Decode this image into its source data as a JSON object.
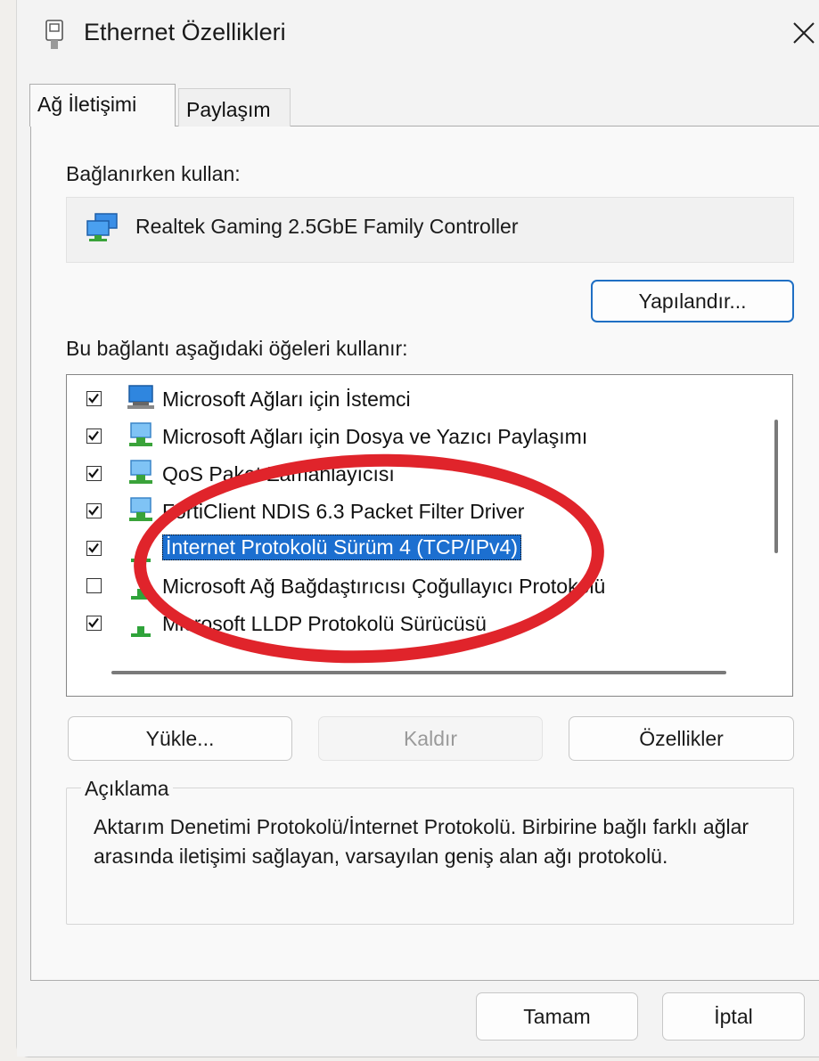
{
  "window": {
    "title": "Ethernet Özellikleri",
    "close_icon": "close-icon"
  },
  "tabs": [
    {
      "label": "Ağ İletişimi",
      "active": true
    },
    {
      "label": "Paylaşım",
      "active": false
    }
  ],
  "connect_using": {
    "label": "Bağlanırken kullan:",
    "adapter": "Realtek Gaming 2.5GbE Family Controller",
    "configure_button": "Yapılandır..."
  },
  "items_section": {
    "label": "Bu bağlantı aşağıdaki öğeleri kullanır:",
    "items": [
      {
        "label": "Microsoft Ağları için İstemci",
        "checked": true,
        "icon": "network-client-icon",
        "selected": false
      },
      {
        "label": "Microsoft Ağları için Dosya ve Yazıcı Paylaşımı",
        "checked": true,
        "icon": "network-service-icon",
        "selected": false
      },
      {
        "label": "QoS Paket Zamanlayıcısı",
        "checked": true,
        "icon": "network-service-icon",
        "selected": false
      },
      {
        "label": "FortiClient NDIS 6.3 Packet Filter Driver",
        "checked": true,
        "icon": "network-service-icon",
        "selected": false
      },
      {
        "label": "İnternet Protokolü Sürüm 4 (TCP/IPv4)",
        "checked": true,
        "icon": "protocol-icon",
        "selected": true
      },
      {
        "label": "Microsoft Ağ Bağdaştırıcısı Çoğullayıcı Protokolü",
        "checked": false,
        "icon": "protocol-icon",
        "selected": false
      },
      {
        "label": "Microsoft LLDP Protokolü Sürücüsü",
        "checked": true,
        "icon": "protocol-icon",
        "selected": false
      }
    ]
  },
  "buttons": {
    "install": "Yükle...",
    "uninstall": "Kaldır",
    "properties": "Özellikler"
  },
  "description": {
    "legend": "Açıklama",
    "text": "Aktarım Denetimi Protokolü/İnternet Protokolü. Birbirine bağlı farklı ağlar arasında iletişimi sağlayan, varsayılan geniş alan ağı protokolü."
  },
  "footer": {
    "ok": "Tamam",
    "cancel": "İptal"
  },
  "colors": {
    "selection": "#1c6fd0",
    "annotation": "#e0242b",
    "accent": "#1f6fc4"
  }
}
